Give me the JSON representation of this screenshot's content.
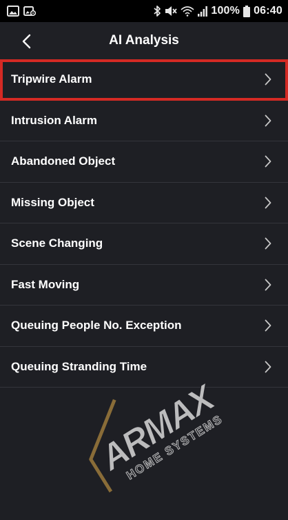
{
  "status_bar": {
    "battery_percent": "100%",
    "time": "06:40",
    "icons": [
      "gallery-icon",
      "image-settings-icon",
      "bluetooth-icon",
      "mute-icon",
      "wifi-icon",
      "signal-icon",
      "battery-icon"
    ]
  },
  "header": {
    "title": "AI Analysis",
    "back_icon": "chevron-left-icon"
  },
  "menu": {
    "items": [
      {
        "label": "Tripwire Alarm",
        "highlighted": true
      },
      {
        "label": "Intrusion Alarm"
      },
      {
        "label": "Abandoned Object"
      },
      {
        "label": "Missing Object"
      },
      {
        "label": "Scene Changing"
      },
      {
        "label": "Fast Moving"
      },
      {
        "label": "Queuing People No. Exception"
      },
      {
        "label": "Queuing Stranding Time"
      }
    ],
    "chevron_icon": "chevron-right-icon"
  },
  "watermark": {
    "brand": "ARMAX",
    "tagline": "HOME SYSTEMS"
  },
  "colors": {
    "background": "#1e1f24",
    "status_bar": "#000000",
    "divider": "#34353b",
    "highlight_border": "#d42a24",
    "text": "#ffffff",
    "chevron": "#c8c8c8",
    "watermark_gold": "#9c7a3c"
  }
}
